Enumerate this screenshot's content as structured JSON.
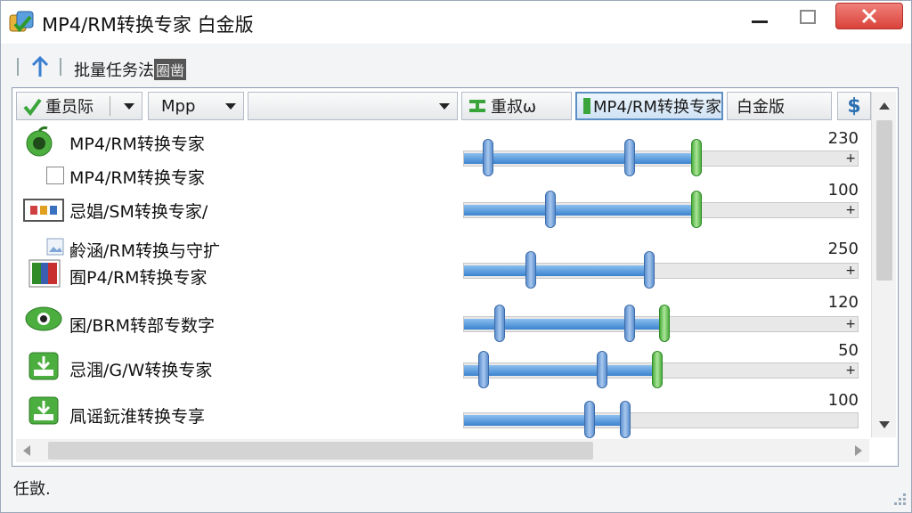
{
  "window": {
    "title": "MP4/RM转换专家 白金版",
    "accent": "#3b82cf",
    "close_color": "#d9433a"
  },
  "tabrow": {
    "label": "批量任务法",
    "badge": "圈凿"
  },
  "toolbar": {
    "item1_label": "重员际",
    "item2_label": "Mpp",
    "item3_label": "",
    "item4_label": "重叔ω",
    "item5_label": "MP4/RM转换专家",
    "item6_label": "白金版",
    "item7_label": "$"
  },
  "rows": [
    {
      "label": "MP4/RM转换专家",
      "icon": "green-apple-icon"
    },
    {
      "label": "MP4/RM转换专家",
      "icon": "checkbox-icon",
      "value": "230",
      "thumbs": [
        0.06,
        0.42,
        0.59
      ],
      "fill": 0.59
    },
    {
      "label": "忌娼/SM转换专家/",
      "icon": "film-strip-icon",
      "value": "100",
      "thumbs": [
        0.22,
        0.59
      ],
      "fill": 0.59
    },
    {
      "label": "鹷涵/RM转换与守扩",
      "icon": "image-icon"
    },
    {
      "label": "囿P4/RM转换专家",
      "icon": "flag-icon",
      "value": "250",
      "thumbs": [
        0.17,
        0.47
      ],
      "fill": 0.47
    },
    {
      "label": "囷/BRM转部专数字",
      "icon": "eye-icon",
      "value": "120",
      "thumbs": [
        0.09,
        0.42,
        0.51
      ],
      "fill": 0.51
    },
    {
      "label": "忌涠/G/W转换专家",
      "icon": "download-icon",
      "value": "50",
      "thumbs": [
        0.05,
        0.35,
        0.49
      ],
      "fill": 0.49
    },
    {
      "label": "凬谣鈨淮转换专享",
      "icon": "download-icon",
      "value": "100",
      "thumbs": [
        0.32,
        0.41
      ],
      "fill": 0.41
    }
  ],
  "status": {
    "text": "任敳."
  }
}
